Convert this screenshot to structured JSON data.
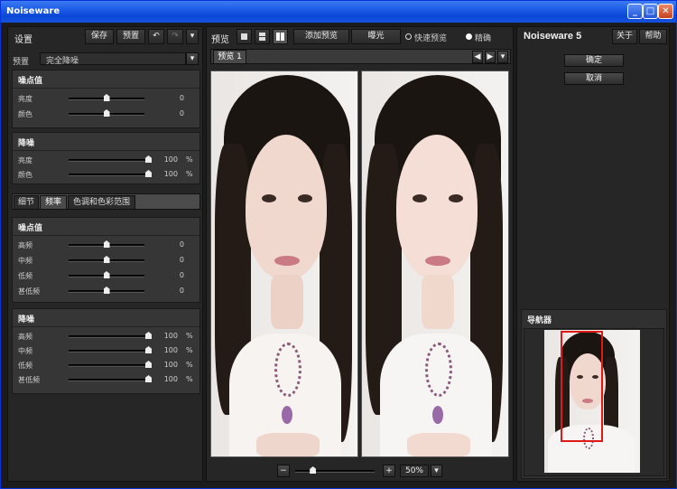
{
  "window": {
    "title": "Noiseware"
  },
  "left": {
    "header": {
      "title": "设置",
      "save": "保存",
      "preset_btn": "预置"
    },
    "preset": {
      "label": "预置",
      "value": "完全降噪"
    },
    "noise_level": {
      "title": "噪点值",
      "rows": [
        {
          "label": "亮度",
          "value": "0",
          "level": 0.5
        },
        {
          "label": "颜色",
          "value": "0",
          "level": 0.5
        }
      ]
    },
    "noise_reduction": {
      "title": "降噪",
      "rows": [
        {
          "label": "亮度",
          "value": "100",
          "unit": "%",
          "level": 1.0
        },
        {
          "label": "颜色",
          "value": "100",
          "unit": "%",
          "level": 1.0
        }
      ]
    },
    "tabs": [
      "细节",
      "频率",
      "色调和色彩范围"
    ],
    "freq_noise_level": {
      "title": "噪点值",
      "rows": [
        {
          "label": "高频",
          "value": "0",
          "level": 0.5
        },
        {
          "label": "中频",
          "value": "0",
          "level": 0.5
        },
        {
          "label": "低频",
          "value": "0",
          "level": 0.5
        },
        {
          "label": "甚低频",
          "value": "0",
          "level": 0.5
        }
      ]
    },
    "freq_noise_reduction": {
      "title": "降噪",
      "rows": [
        {
          "label": "高频",
          "value": "100",
          "unit": "%",
          "level": 1.0
        },
        {
          "label": "中频",
          "value": "100",
          "unit": "%",
          "level": 1.0
        },
        {
          "label": "低频",
          "value": "100",
          "unit": "%",
          "level": 1.0
        },
        {
          "label": "甚低频",
          "value": "100",
          "unit": "%",
          "level": 1.0
        }
      ]
    }
  },
  "center": {
    "toolbar": {
      "preview_label": "预览",
      "add_preview": "添加预览",
      "exposure": "曝光",
      "fast_preview": "快速预览",
      "accurate": "精确"
    },
    "preview_tab": "预览 1",
    "zoom": {
      "value": "50%",
      "minus": "−",
      "plus": "+",
      "level": 0.2
    }
  },
  "right": {
    "brand": "Noiseware 5",
    "about": "关于",
    "help": "帮助",
    "ok": "确定",
    "cancel": "取消",
    "navigator": "导航器"
  },
  "colors": {
    "titlebar": "#0a47d6",
    "panel": "#262626",
    "section": "#363636",
    "nav_frame": "#e01818"
  }
}
